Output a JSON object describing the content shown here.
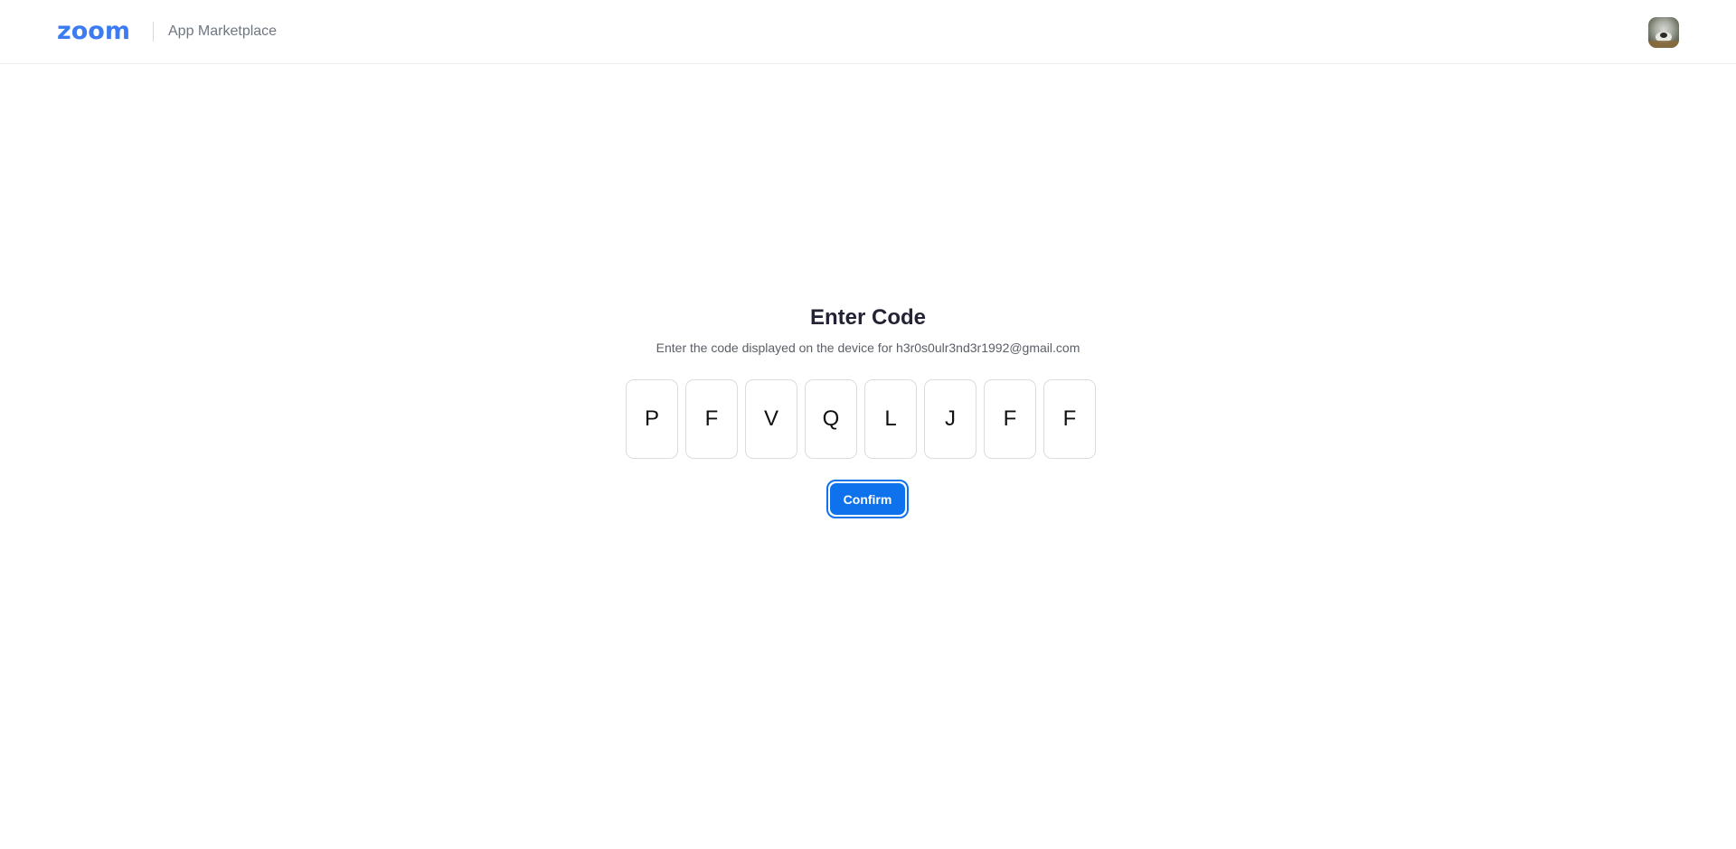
{
  "header": {
    "logo_text": "zoom",
    "section_label": "App Marketplace",
    "avatar_icon": "user-avatar-icon"
  },
  "main": {
    "title": "Enter Code",
    "subtitle": "Enter the code displayed on the device for h3r0s0ulr3nd3r1992@gmail.com",
    "code": [
      "P",
      "F",
      "V",
      "Q",
      "L",
      "J",
      "F",
      "F"
    ],
    "confirm_label": "Confirm"
  },
  "colors": {
    "brand": "#3d7cf0",
    "primary_button": "#0e72ed",
    "title_text": "#232333",
    "muted_text": "#6e7680"
  }
}
